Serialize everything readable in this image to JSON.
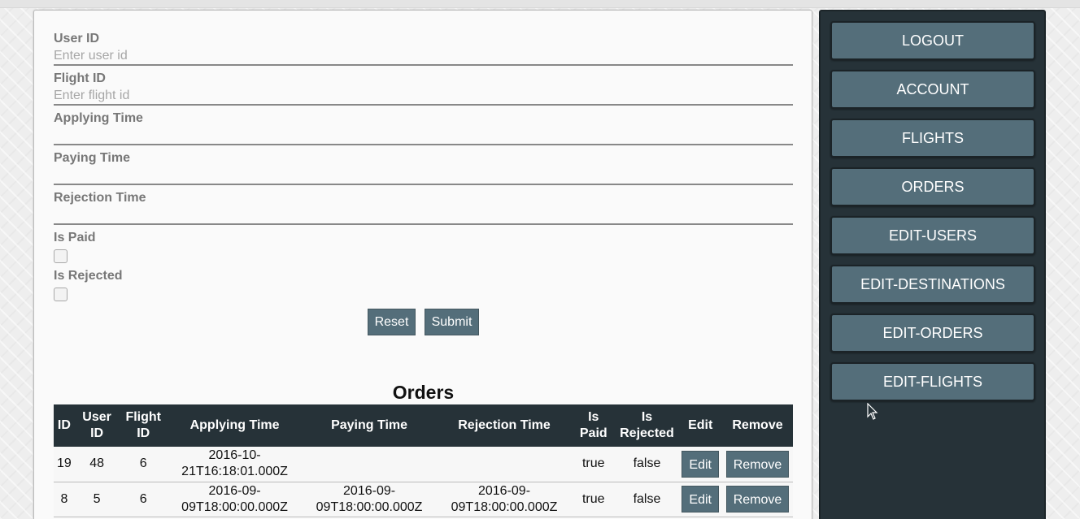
{
  "form": {
    "user_id_label": "User ID",
    "user_id_placeholder": "Enter user id",
    "flight_id_label": "Flight ID",
    "flight_id_placeholder": "Enter flight id",
    "applying_time_label": "Applying Time",
    "paying_time_label": "Paying Time",
    "rejection_time_label": "Rejection Time",
    "is_paid_label": "Is Paid",
    "is_rejected_label": "Is Rejected",
    "reset_label": "Reset",
    "submit_label": "Submit"
  },
  "orders": {
    "title": "Orders",
    "columns": [
      "ID",
      "User ID",
      "Flight ID",
      "Applying Time",
      "Paying Time",
      "Rejection Time",
      "Is Paid",
      "Is Rejected",
      "Edit",
      "Remove"
    ],
    "rows": [
      {
        "id": "19",
        "user_id": "48",
        "flight_id": "6",
        "applying_time": "2016-10-21T16:18:01.000Z",
        "paying_time": "",
        "rejection_time": "",
        "is_paid": "true",
        "is_rejected": "false",
        "edit_label": "Edit",
        "remove_label": "Remove"
      },
      {
        "id": "8",
        "user_id": "5",
        "flight_id": "6",
        "applying_time": "2016-09-09T18:00:00.000Z",
        "paying_time": "2016-09-09T18:00:00.000Z",
        "rejection_time": "2016-09-09T18:00:00.000Z",
        "is_paid": "true",
        "is_rejected": "false",
        "edit_label": "Edit",
        "remove_label": "Remove"
      }
    ]
  },
  "nav": {
    "items": [
      {
        "label": "LOGOUT"
      },
      {
        "label": "ACCOUNT"
      },
      {
        "label": "FLIGHTS"
      },
      {
        "label": "ORDERS"
      },
      {
        "label": "EDIT-USERS"
      },
      {
        "label": "EDIT-DESTINATIONS"
      },
      {
        "label": "EDIT-ORDERS"
      },
      {
        "label": "EDIT-FLIGHTS"
      }
    ]
  },
  "colors": {
    "button": "#546e7a",
    "table_header": "#263238",
    "sidebar": "#263238"
  }
}
